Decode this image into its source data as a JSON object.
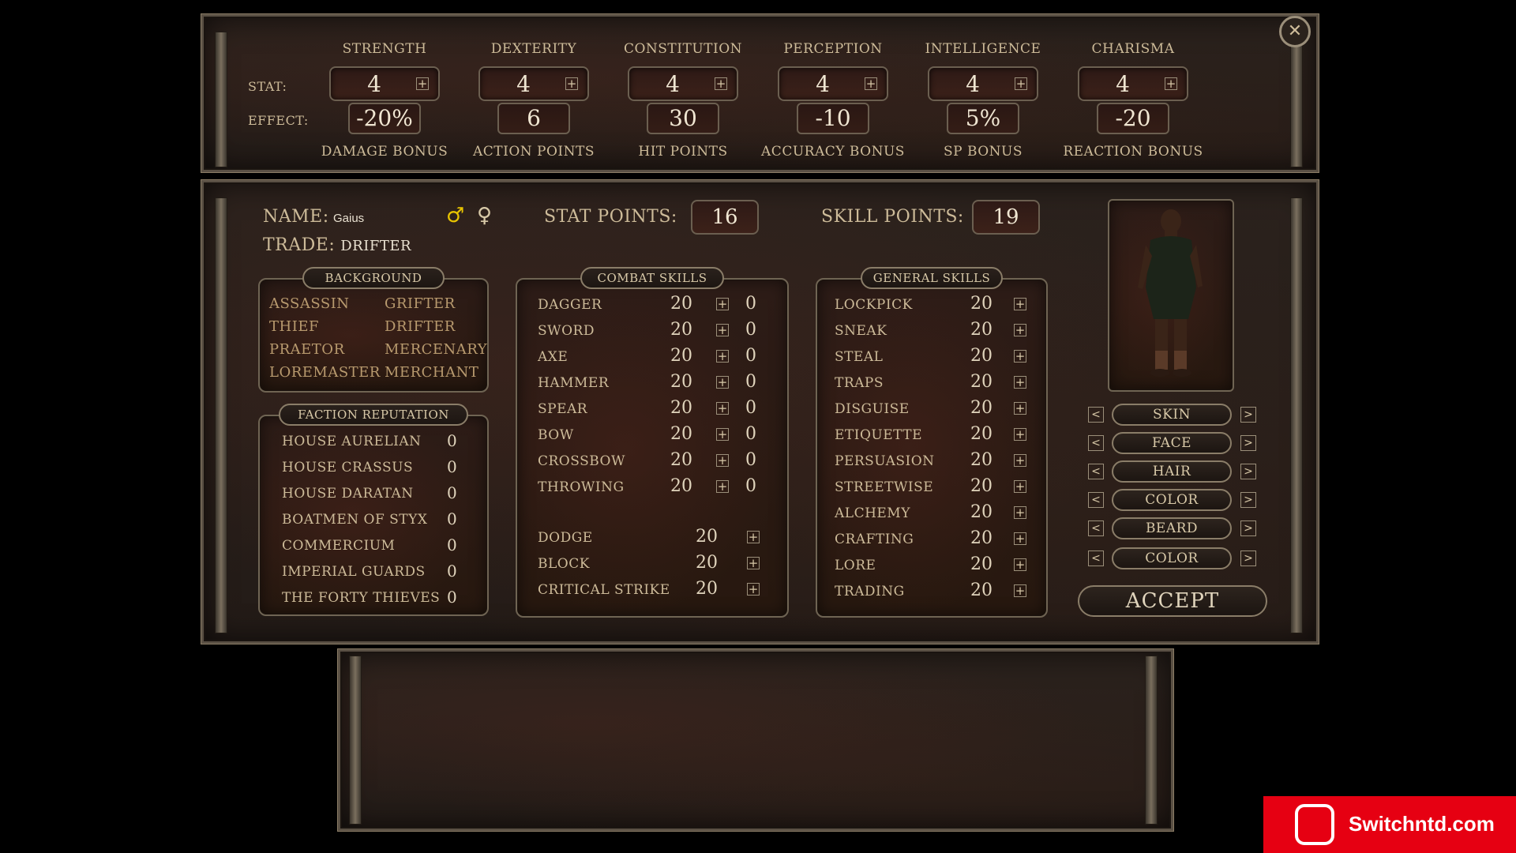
{
  "attributes": [
    {
      "name": "STRENGTH",
      "stat": "4",
      "effect": "-20%",
      "effect_label": "DAMAGE BONUS"
    },
    {
      "name": "DEXTERITY",
      "stat": "4",
      "effect": "6",
      "effect_label": "ACTION POINTS"
    },
    {
      "name": "CONSTITUTION",
      "stat": "4",
      "effect": "30",
      "effect_label": "HIT POINTS"
    },
    {
      "name": "PERCEPTION",
      "stat": "4",
      "effect": "-10",
      "effect_label": "ACCURACY BONUS"
    },
    {
      "name": "INTELLIGENCE",
      "stat": "4",
      "effect": "5%",
      "effect_label": "SP BONUS"
    },
    {
      "name": "CHARISMA",
      "stat": "4",
      "effect": "-20",
      "effect_label": "REACTION BONUS"
    }
  ],
  "labels": {
    "stat": "STAT:",
    "effect": "EFFECT:"
  },
  "character": {
    "name_label": "NAME:",
    "name": "Gaius",
    "trade_label": "TRADE:",
    "trade": "DRIFTER",
    "male_symbol": "♂",
    "female_symbol": "♀",
    "stat_points_label": "STAT POINTS:",
    "stat_points": "16",
    "skill_points_label": "SKILL POINTS:",
    "skill_points": "19"
  },
  "background": {
    "title": "BACKGROUND",
    "items": [
      "ASSASSIN",
      "GRIFTER",
      "THIEF",
      "DRIFTER",
      "PRAETOR",
      "MERCENARY",
      "LOREMASTER",
      "MERCHANT"
    ]
  },
  "factions": {
    "title": "FACTION REPUTATION",
    "items": [
      {
        "name": "HOUSE AURELIAN",
        "value": "0"
      },
      {
        "name": "HOUSE CRASSUS",
        "value": "0"
      },
      {
        "name": "HOUSE DARATAN",
        "value": "0"
      },
      {
        "name": "BOATMEN OF STYX",
        "value": "0"
      },
      {
        "name": "COMMERCIUM",
        "value": "0"
      },
      {
        "name": "IMPERIAL GUARDS",
        "value": "0"
      },
      {
        "name": "THE FORTY THIEVES",
        "value": "0"
      }
    ]
  },
  "combat_skills": {
    "title": "COMBAT SKILLS",
    "weapons": [
      {
        "name": "DAGGER",
        "value": "20",
        "bonus": "0"
      },
      {
        "name": "SWORD",
        "value": "20",
        "bonus": "0"
      },
      {
        "name": "AXE",
        "value": "20",
        "bonus": "0"
      },
      {
        "name": "HAMMER",
        "value": "20",
        "bonus": "0"
      },
      {
        "name": "SPEAR",
        "value": "20",
        "bonus": "0"
      },
      {
        "name": "BOW",
        "value": "20",
        "bonus": "0"
      },
      {
        "name": "CROSSBOW",
        "value": "20",
        "bonus": "0"
      },
      {
        "name": "THROWING",
        "value": "20",
        "bonus": "0"
      }
    ],
    "defense": [
      {
        "name": "DODGE",
        "value": "20"
      },
      {
        "name": "BLOCK",
        "value": "20"
      },
      {
        "name": "CRITICAL STRIKE",
        "value": "20"
      }
    ]
  },
  "general_skills": {
    "title": "GENERAL SKILLS",
    "items": [
      {
        "name": "LOCKPICK",
        "value": "20"
      },
      {
        "name": "SNEAK",
        "value": "20"
      },
      {
        "name": "STEAL",
        "value": "20"
      },
      {
        "name": "TRAPS",
        "value": "20"
      },
      {
        "name": "DISGUISE",
        "value": "20"
      },
      {
        "name": "ETIQUETTE",
        "value": "20"
      },
      {
        "name": "PERSUASION",
        "value": "20"
      },
      {
        "name": "STREETWISE",
        "value": "20"
      },
      {
        "name": "ALCHEMY",
        "value": "20"
      },
      {
        "name": "CRAFTING",
        "value": "20"
      },
      {
        "name": "LORE",
        "value": "20"
      },
      {
        "name": "TRADING",
        "value": "20"
      }
    ]
  },
  "appearance": {
    "options": [
      "SKIN",
      "FACE",
      "HAIR",
      "COLOR",
      "BEARD",
      "COLOR"
    ],
    "prev": "<",
    "next": ">",
    "accept": "ACCEPT"
  },
  "plus_symbol": "+",
  "close_symbol": "✕",
  "watermark": "Switchntd.com"
}
